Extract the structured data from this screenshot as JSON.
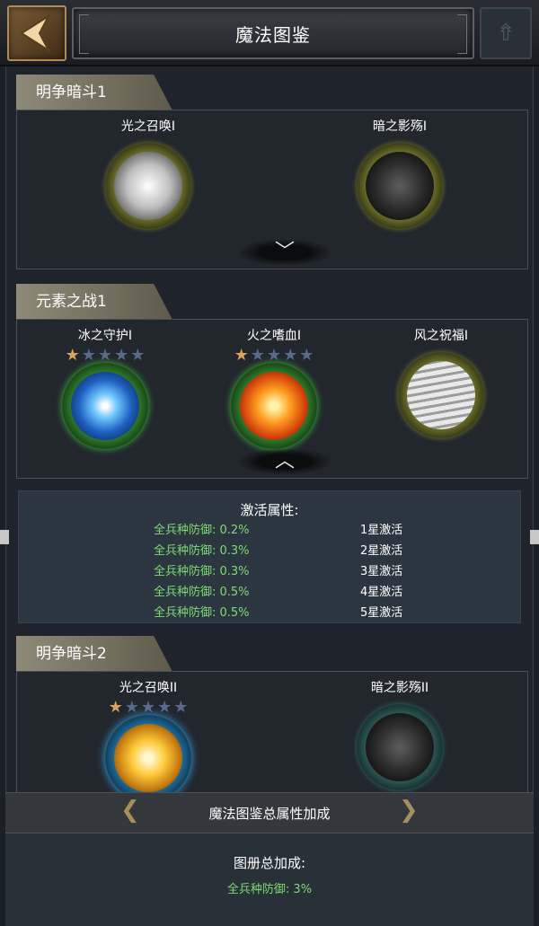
{
  "header": {
    "title": "魔法图鉴",
    "back_icon": "back-arrow-icon",
    "help_icon": "arrow-up-icon"
  },
  "sections": [
    {
      "title": "明争暗斗1",
      "cards": [
        {
          "name": "光之召唤I",
          "orb": "olive",
          "core": "light",
          "stars": null
        },
        {
          "name": "暗之影殇I",
          "orb": "olive",
          "core": "dark",
          "stars": null
        }
      ],
      "toggle": "﹀"
    },
    {
      "title": "元素之战1",
      "cards": [
        {
          "name": "冰之守护I",
          "orb": "green",
          "core": "ice",
          "stars": 1
        },
        {
          "name": "火之嗜血I",
          "orb": "green",
          "core": "fire",
          "stars": 1
        },
        {
          "name": "风之祝福I",
          "orb": "olive",
          "core": "wind",
          "stars": null
        }
      ],
      "toggle": "︿"
    },
    {
      "title": "明争暗斗2",
      "cards": [
        {
          "name": "光之召唤II",
          "orb": "blue",
          "core": "gold",
          "stars": 1
        },
        {
          "name": "暗之影殇II",
          "orb": "teal",
          "core": "dark",
          "stars": null
        }
      ]
    }
  ],
  "activation": {
    "title": "激活属性:",
    "rows": [
      {
        "value": "全兵种防御: 0.2%",
        "level": "1星激活"
      },
      {
        "value": "全兵种防御: 0.3%",
        "level": "2星激活"
      },
      {
        "value": "全兵种防御: 0.3%",
        "level": "3星激活"
      },
      {
        "value": "全兵种防御: 0.5%",
        "level": "4星激活"
      },
      {
        "value": "全兵种防御: 0.5%",
        "level": "5星激活"
      }
    ]
  },
  "bonus_bar": {
    "label": "魔法图鉴总属性加成"
  },
  "total": {
    "title": "图册总加成:",
    "value": "全兵种防御: 3%"
  },
  "colors": {
    "accent_green": "#7fdc76",
    "star_on": "#d9a55a",
    "star_off": "#5b6a8c"
  }
}
